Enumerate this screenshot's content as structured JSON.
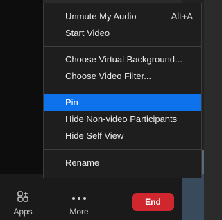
{
  "menu": {
    "items": [
      {
        "label": "Unmute My Audio",
        "shortcut": "Alt+A"
      },
      {
        "label": "Start Video"
      },
      {
        "label": "Choose Virtual Background..."
      },
      {
        "label": "Choose Video Filter..."
      },
      {
        "label": "Pin",
        "selected": true
      },
      {
        "label": "Hide Non-video Participants"
      },
      {
        "label": "Hide Self View"
      },
      {
        "label": "Rename"
      }
    ]
  },
  "toolbar": {
    "apps_label": "Apps",
    "more_label": "More",
    "end_label": "End"
  },
  "colors": {
    "highlight": "#0e72ed",
    "end_button": "#d0262e",
    "menu_bg": "#1e1e1e"
  },
  "icons": {
    "apps": "apps-icon",
    "more": "more-dots-icon"
  }
}
